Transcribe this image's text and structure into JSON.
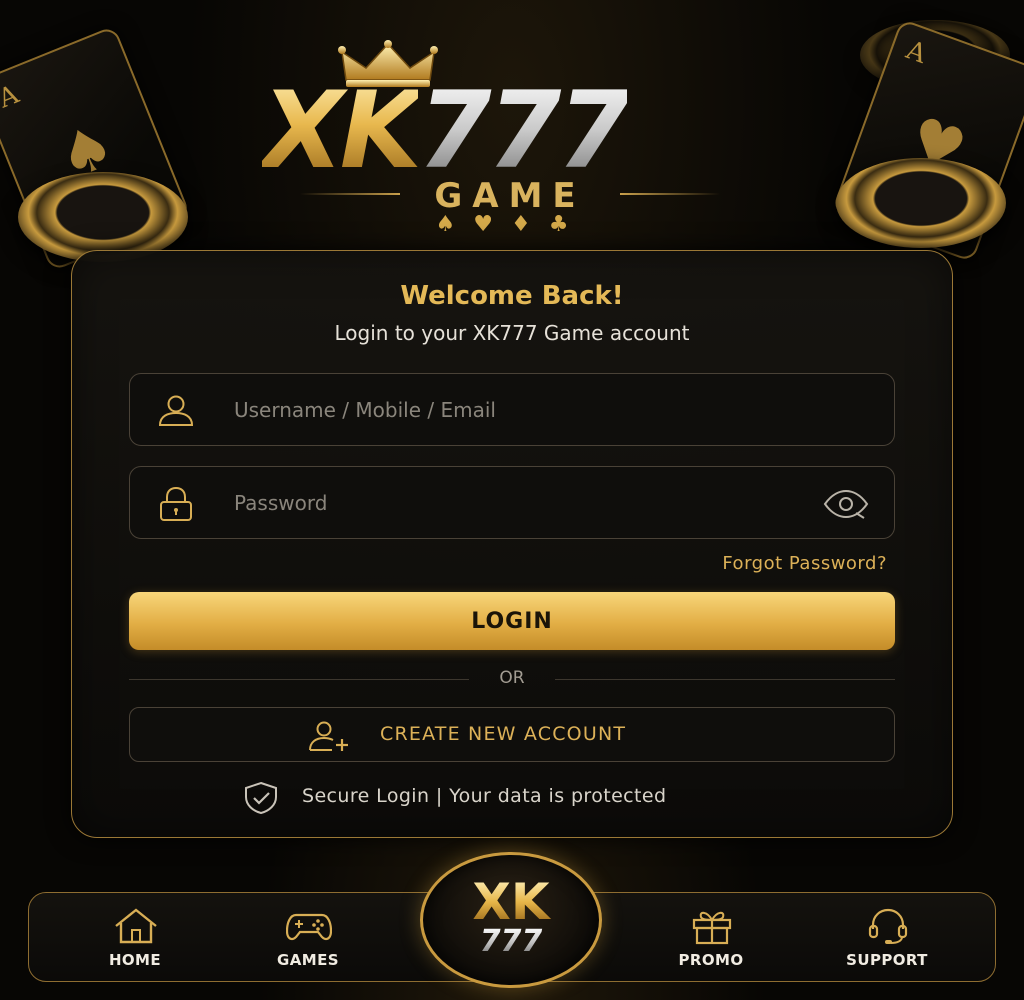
{
  "logo": {
    "main_gold": "XK",
    "main_silver": "777",
    "sub": "GAME",
    "suits": "♠♥♦♣"
  },
  "decor": {
    "left_card_rank": "A",
    "left_card_suit": "♠",
    "right_card_rank": "A",
    "right_card_suit": "♥"
  },
  "login": {
    "title": "Welcome Back!",
    "subtitle": "Login to your XK777 Game account",
    "username_placeholder": "Username / Mobile / Email",
    "password_placeholder": "Password",
    "forgot_label": "Forgot Password?",
    "login_label": "LOGIN",
    "or_label": "OR",
    "create_label": "CREATE NEW ACCOUNT",
    "secure_text": "Secure Login  |  Your data is protected"
  },
  "nav": {
    "items": [
      {
        "label": "HOME",
        "icon": "home-icon"
      },
      {
        "label": "GAMES",
        "icon": "gamepad-icon"
      },
      {
        "label": "PROMO",
        "icon": "gift-icon"
      },
      {
        "label": "SUPPORT",
        "icon": "headset-icon"
      }
    ],
    "center_top": "XK",
    "center_bottom": "777"
  },
  "colors": {
    "accent_gold": "#e4b957",
    "background": "#070604",
    "panel_border": "#9b7836"
  }
}
